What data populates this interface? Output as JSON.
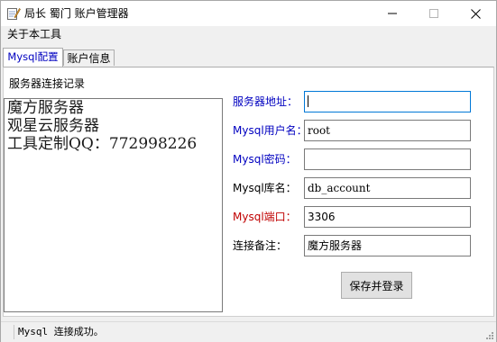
{
  "window": {
    "title": "局长 蜀门 账户管理器"
  },
  "menu": {
    "about": "关于本工具"
  },
  "tabs": [
    {
      "label": "Mysql配置"
    },
    {
      "label": "账户信息"
    }
  ],
  "records_panel": {
    "heading": "服务器连接记录",
    "lines": [
      "魔方服务器",
      "观星云服务器",
      "工具定制QQ：772998226"
    ]
  },
  "form": {
    "server_address": {
      "label": "服务器地址：",
      "value": ""
    },
    "username": {
      "label": "Mysql用户名：",
      "value": "root"
    },
    "password": {
      "label": "Mysql密码：",
      "value": ""
    },
    "database": {
      "label": "Mysql库名：",
      "value": "db_account"
    },
    "port": {
      "label": "Mysql端口：",
      "value": "3306"
    },
    "note": {
      "label": "连接备注：",
      "value": "魔方服务器"
    }
  },
  "buttons": {
    "save_login": "保存并登录"
  },
  "status": {
    "text": "Mysql 连接成功。"
  },
  "colors": {
    "label_blue": "#0000c0",
    "label_red": "#c00000",
    "focus_border": "#0078d7"
  }
}
